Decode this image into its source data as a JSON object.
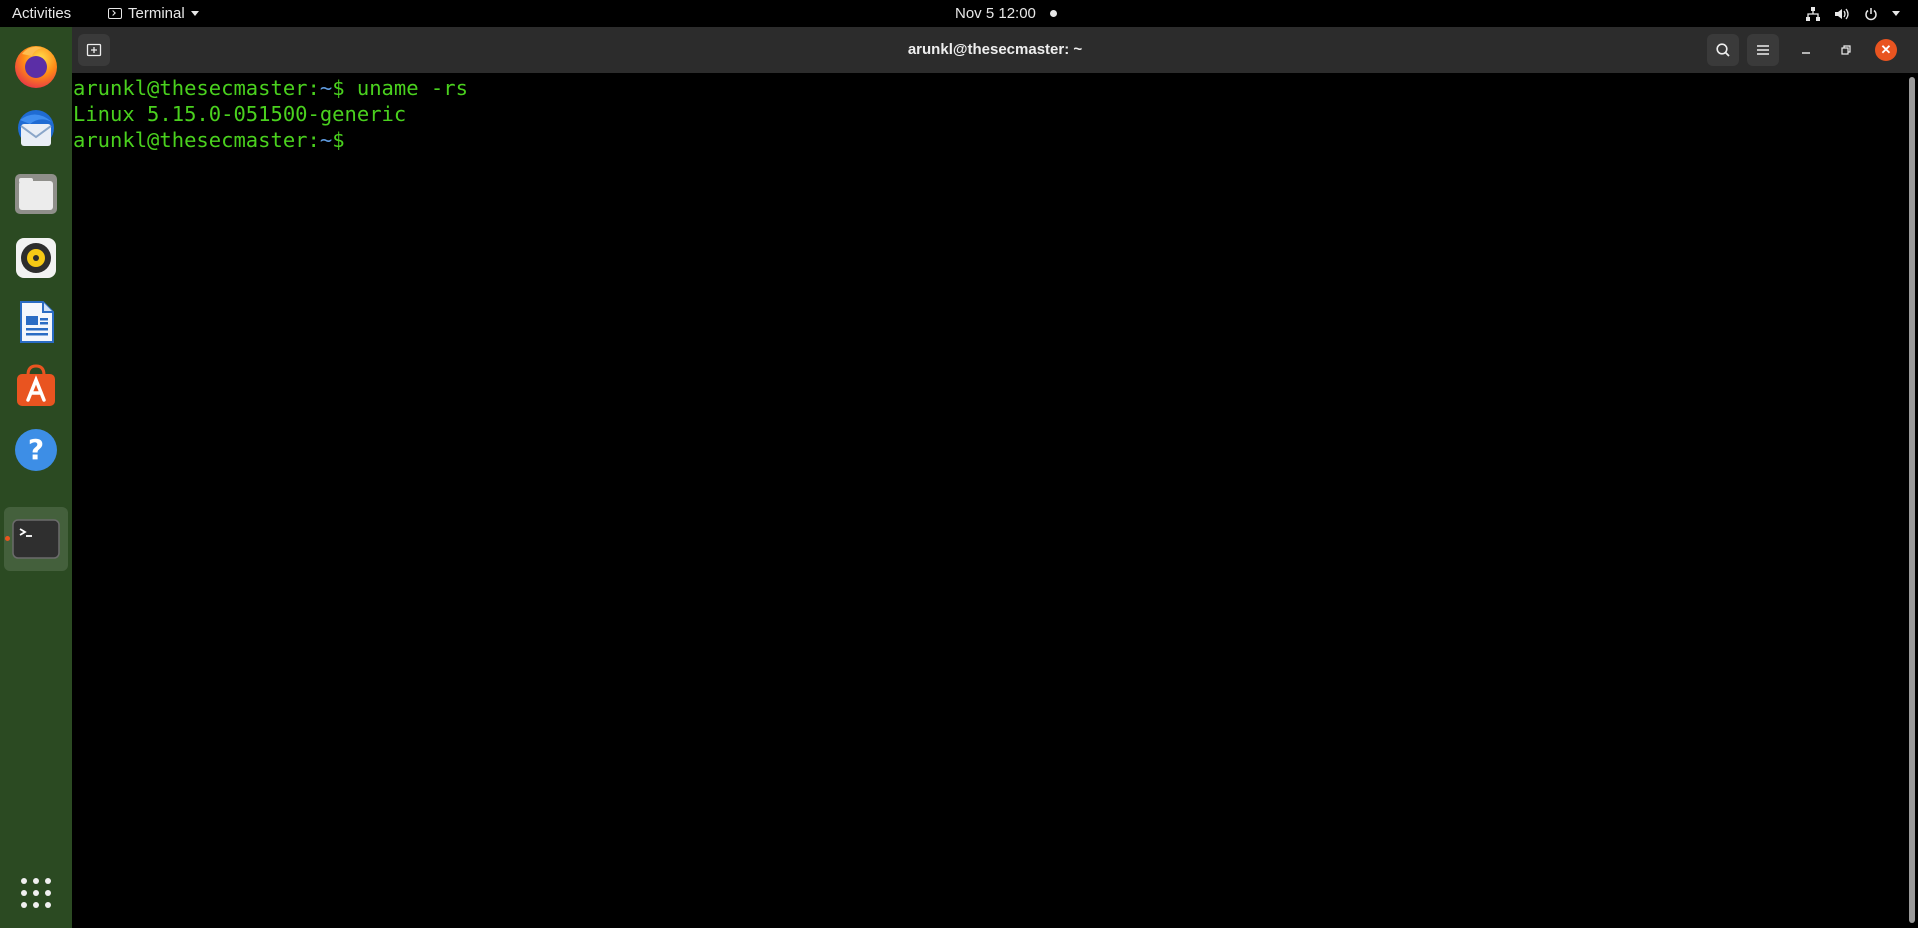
{
  "topbar": {
    "activities": "Activities",
    "app_menu_label": "Terminal",
    "clock": "Nov 5  12:00"
  },
  "dock": {
    "items": [
      "firefox",
      "thunderbird",
      "files",
      "rhythmbox",
      "libreoffice-writer",
      "ubuntu-software",
      "help",
      "terminal"
    ],
    "active": "terminal"
  },
  "window": {
    "title": "arunkl@thesecmaster: ~"
  },
  "terminal": {
    "lines": [
      {
        "user": "arunkl@thesecmaster",
        "sep": ":",
        "path": "~",
        "prompt": "$ ",
        "command": "uname -rs"
      },
      {
        "output": "Linux 5.15.0-051500-generic"
      },
      {
        "user": "arunkl@thesecmaster",
        "sep": ":",
        "path": "~",
        "prompt": "$ ",
        "command": ""
      }
    ]
  },
  "colors": {
    "prompt_user": "#4ad11e",
    "prompt_path": "#5f9bdf",
    "dock_bg": "#2b4a22",
    "close_button": "#e95420"
  }
}
